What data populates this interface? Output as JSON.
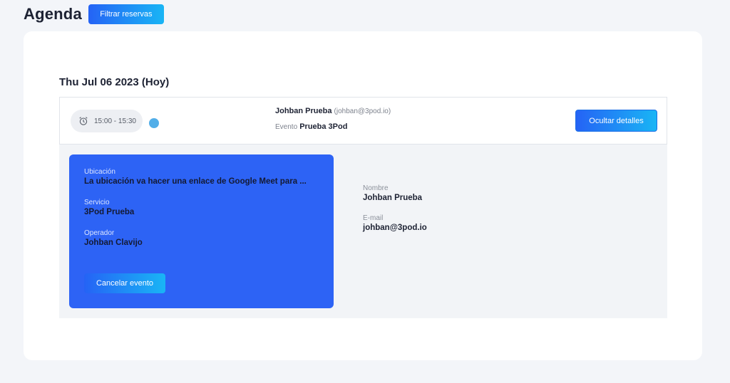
{
  "header": {
    "title": "Agenda",
    "filter_button": "Filtrar reservas"
  },
  "day": {
    "date_label": "Thu Jul 06 2023 (Hoy)"
  },
  "event": {
    "time_range": "15:00 - 15:30",
    "status_color": "#52aee8",
    "attendee_name": "Johban Prueba",
    "attendee_email": "(johban@3pod.io)",
    "event_label": "Evento",
    "event_name": "Prueba 3Pod",
    "hide_details_button": "Ocultar detalles"
  },
  "details": {
    "location_label": "Ubicación",
    "location_value": "La ubicación va hacer una enlace de Google Meet para ...",
    "service_label": "Servicio",
    "service_value": "3Pod Prueba",
    "operator_label": "Operador",
    "operator_value": "Johban Clavijo",
    "cancel_button": "Cancelar evento",
    "name_label": "Nombre",
    "name_value": "Johban Prueba",
    "email_label": "E-mail",
    "email_value": "johban@3pod.io"
  },
  "colors": {
    "accent": "#2563f5",
    "accent_gradient_end": "#19b5f5",
    "panel": "#2d63f5",
    "background": "#f3f5f9"
  },
  "icons": {
    "time": "alarm-clock-icon"
  }
}
